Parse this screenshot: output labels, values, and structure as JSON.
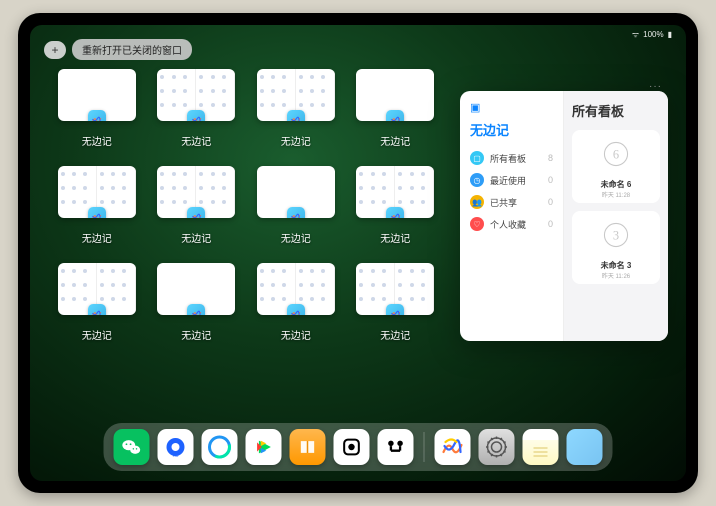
{
  "status": {
    "battery": "100%",
    "wifi": "●●●"
  },
  "top": {
    "add": "+",
    "reopen_label": "重新打开已关闭的窗口"
  },
  "app_switcher": {
    "app_name": "无边记",
    "windows": [
      {
        "label": "无边记",
        "split": false
      },
      {
        "label": "无边记",
        "split": true
      },
      {
        "label": "无边记",
        "split": true
      },
      {
        "label": "无边记",
        "split": false
      },
      {
        "label": "无边记",
        "split": true
      },
      {
        "label": "无边记",
        "split": true
      },
      {
        "label": "无边记",
        "split": false
      },
      {
        "label": "无边记",
        "split": true
      },
      {
        "label": "无边记",
        "split": true
      },
      {
        "label": "无边记",
        "split": false
      },
      {
        "label": "无边记",
        "split": true
      },
      {
        "label": "无边记",
        "split": true
      }
    ]
  },
  "popup": {
    "more": "···",
    "left_title": "无边记",
    "right_title": "所有看板",
    "menu": [
      {
        "name": "all-boards",
        "icon_bg": "#34c8f5",
        "glyph": "▢",
        "label": "所有看板",
        "count": "8"
      },
      {
        "name": "recent",
        "icon_bg": "#2e9df7",
        "glyph": "◷",
        "label": "最近使用",
        "count": "0"
      },
      {
        "name": "shared",
        "icon_bg": "#f5b301",
        "glyph": "👥",
        "label": "已共享",
        "count": "0"
      },
      {
        "name": "favorites",
        "icon_bg": "#ff4d4d",
        "glyph": "♡",
        "label": "个人收藏",
        "count": "0"
      }
    ],
    "boards": [
      {
        "title": "未命名 6",
        "subtitle": "昨天 11:28",
        "digit": "6"
      },
      {
        "title": "未命名 3",
        "subtitle": "昨天 11:26",
        "digit": "3"
      }
    ]
  },
  "dock": {
    "main": [
      {
        "name": "wechat",
        "cls": "di-wechat"
      },
      {
        "name": "qqbrowser",
        "cls": "di-qqb"
      },
      {
        "name": "qq",
        "cls": "di-qq"
      },
      {
        "name": "iqiyi",
        "cls": "di-qiyi"
      },
      {
        "name": "books",
        "cls": "di-books"
      },
      {
        "name": "inshot",
        "cls": "di-inshot"
      },
      {
        "name": "notability",
        "cls": "di-notab"
      }
    ],
    "suggested": [
      {
        "name": "freeform",
        "cls": "di-freeform"
      },
      {
        "name": "settings",
        "cls": "di-settings"
      },
      {
        "name": "notes",
        "cls": "di-notes"
      },
      {
        "name": "app-library",
        "cls": "di-recent"
      }
    ]
  }
}
